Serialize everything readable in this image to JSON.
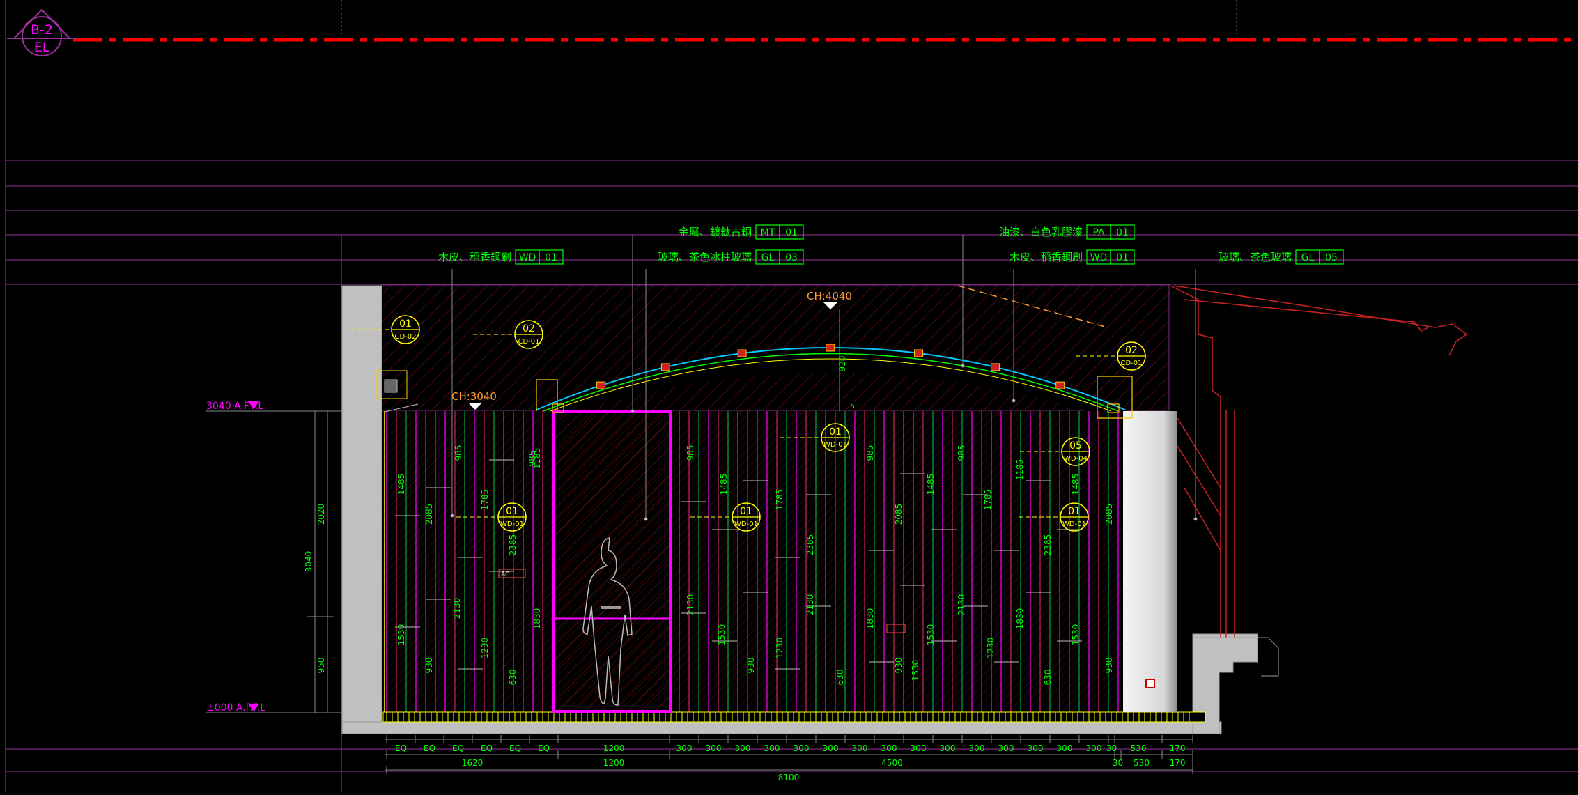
{
  "title_tag": {
    "top": "B-2",
    "bottom": "EL"
  },
  "levels": {
    "ceiling_ffl": "3040 A.F.F.L",
    "floor_ffl": "±000 A.F.F.L"
  },
  "ceiling_heights": {
    "left": "CH:3040",
    "center": "CH:4040"
  },
  "callouts_top": [
    {
      "text": "木皮、稻香鋼刷",
      "code": [
        "WD",
        "01"
      ]
    },
    {
      "text": "金屬、鍍鈦古銅",
      "code": [
        "MT",
        "01"
      ]
    },
    {
      "text": "玻璃、茶色冰柱玻璃",
      "code": [
        "GL",
        "03"
      ]
    },
    {
      "text": "油漆、白色乳膠漆",
      "code": [
        "PA",
        "01"
      ]
    },
    {
      "text": "木皮、稻香鋼刷",
      "code": [
        "WD",
        "01"
      ]
    },
    {
      "text": "玻璃、茶色玻璃",
      "code": [
        "GL",
        "05"
      ]
    }
  ],
  "tags": [
    {
      "num": "01",
      "code": "CD-02"
    },
    {
      "num": "02",
      "code": "CD-01"
    },
    {
      "num": "02",
      "code": "CD-01"
    },
    {
      "num": "01",
      "code": "WD-01"
    },
    {
      "num": "05",
      "code": "WD-04"
    },
    {
      "num": "01",
      "code": "WD-01"
    },
    {
      "num": "01",
      "code": "WD-01"
    },
    {
      "num": "01",
      "code": "WD-01"
    }
  ],
  "vertical_dims": {
    "left_total": "3040",
    "left_upper": "2020",
    "left_lower": "950",
    "arch_rise": "920",
    "small": "5"
  },
  "panel_dims": [
    "1485",
    "985",
    "1785",
    "2385",
    "2085",
    "1185",
    "985",
    "2130",
    "1530",
    "1230",
    "930",
    "630",
    "1830"
  ],
  "bottom_row1": [
    "EQ",
    "EQ",
    "EQ",
    "EQ",
    "EQ",
    "EQ",
    "1200",
    "300",
    "300",
    "300",
    "300",
    "300",
    "300",
    "300",
    "300",
    "300",
    "300",
    "300",
    "300",
    "300",
    "300",
    "300",
    "30",
    "530",
    "170"
  ],
  "bottom_row2": [
    "1620",
    "1200",
    "4500",
    "30",
    "530",
    "170"
  ],
  "bottom_total": "8100",
  "misc": {
    "ac_label": "AC",
    "colors": {
      "green": "#00ff00",
      "magenta": "#ff00ff",
      "red": "#ff0000",
      "yellow": "#ffff00",
      "orange": "#ff9933",
      "purple": "#8c2f8c"
    }
  }
}
